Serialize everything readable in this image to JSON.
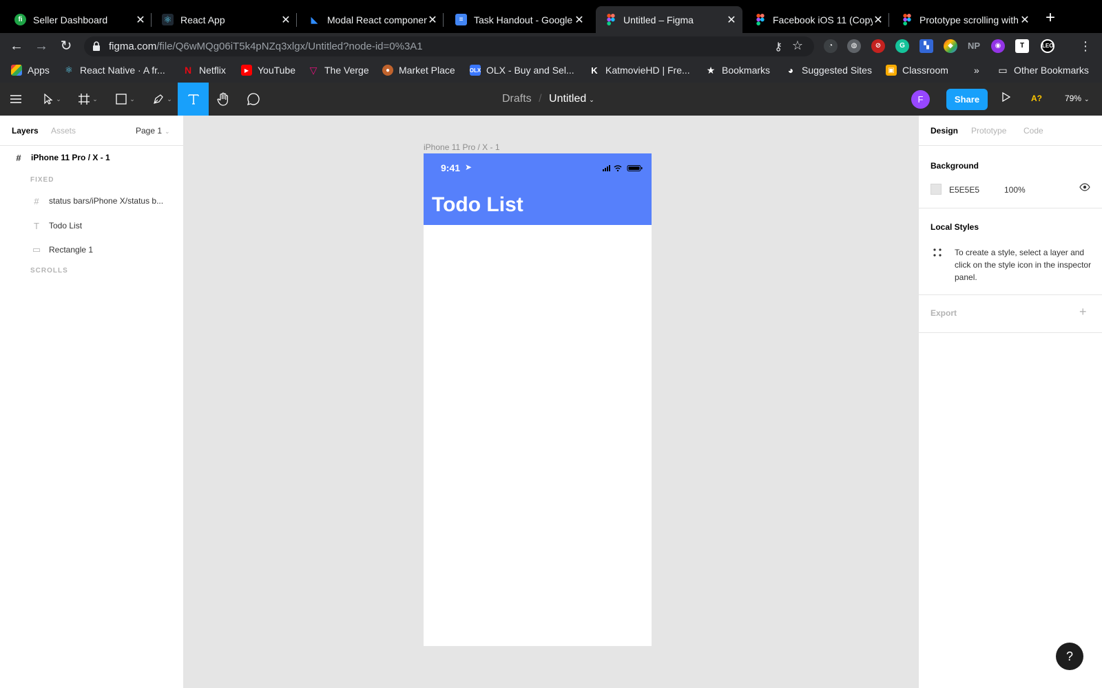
{
  "browser": {
    "tabs": [
      {
        "title": "Seller Dashboard",
        "active": false
      },
      {
        "title": "React App",
        "active": false
      },
      {
        "title": "Modal React component",
        "active": false
      },
      {
        "title": "Task Handout - Google Docs",
        "active": false
      },
      {
        "title": "Untitled – Figma",
        "active": true
      },
      {
        "title": "Facebook iOS 11 (Copy)",
        "active": false
      },
      {
        "title": "Prototype scrolling with",
        "active": false
      }
    ],
    "url_domain": "figma.com",
    "url_path": "/file/Q6wMQg06iT5k4pNZq3xlgx/Untitled?node-id=0%3A1",
    "bookmarks": [
      {
        "label": "Apps"
      },
      {
        "label": "React Native · A fr..."
      },
      {
        "label": "Netflix"
      },
      {
        "label": "YouTube"
      },
      {
        "label": "The Verge"
      },
      {
        "label": "Market Place"
      },
      {
        "label": "OLX - Buy and Sel..."
      },
      {
        "label": "KatmovieHD | Fre..."
      },
      {
        "label": "Bookmarks"
      },
      {
        "label": "Suggested Sites"
      },
      {
        "label": "Classroom"
      },
      {
        "label": "»"
      },
      {
        "label": "Other Bookmarks"
      }
    ],
    "extensions": [
      "NP"
    ]
  },
  "figma": {
    "breadcrumb_root": "Drafts",
    "breadcrumb_sep": "/",
    "file_name": "Untitled",
    "avatar_initial": "F",
    "share_label": "Share",
    "a11y_label": "A?",
    "zoom": "79%",
    "left_panel": {
      "tab_layers": "Layers",
      "tab_assets": "Assets",
      "page": "Page 1",
      "frame_name": "iPhone 11 Pro / X - 1",
      "section_fixed": "FIXED",
      "layers": [
        {
          "name": "status bars/iPhone X/status b...",
          "icon": "#"
        },
        {
          "name": "Todo List",
          "icon": "T"
        },
        {
          "name": "Rectangle 1",
          "icon": "▭"
        }
      ],
      "section_scrolls": "SCROLLS"
    },
    "canvas": {
      "frame_label": "iPhone 11 Pro / X - 1",
      "status_time": "9:41",
      "title": "Todo List",
      "header_color": "#5680FB"
    },
    "right_panel": {
      "tab_design": "Design",
      "tab_prototype": "Prototype",
      "tab_code": "Code",
      "background_heading": "Background",
      "background_hex": "E5E5E5",
      "background_opacity": "100%",
      "local_styles_heading": "Local Styles",
      "local_styles_note": "To create a style, select a layer and click on the style icon in the inspector panel.",
      "export_heading": "Export"
    },
    "help_label": "?"
  }
}
